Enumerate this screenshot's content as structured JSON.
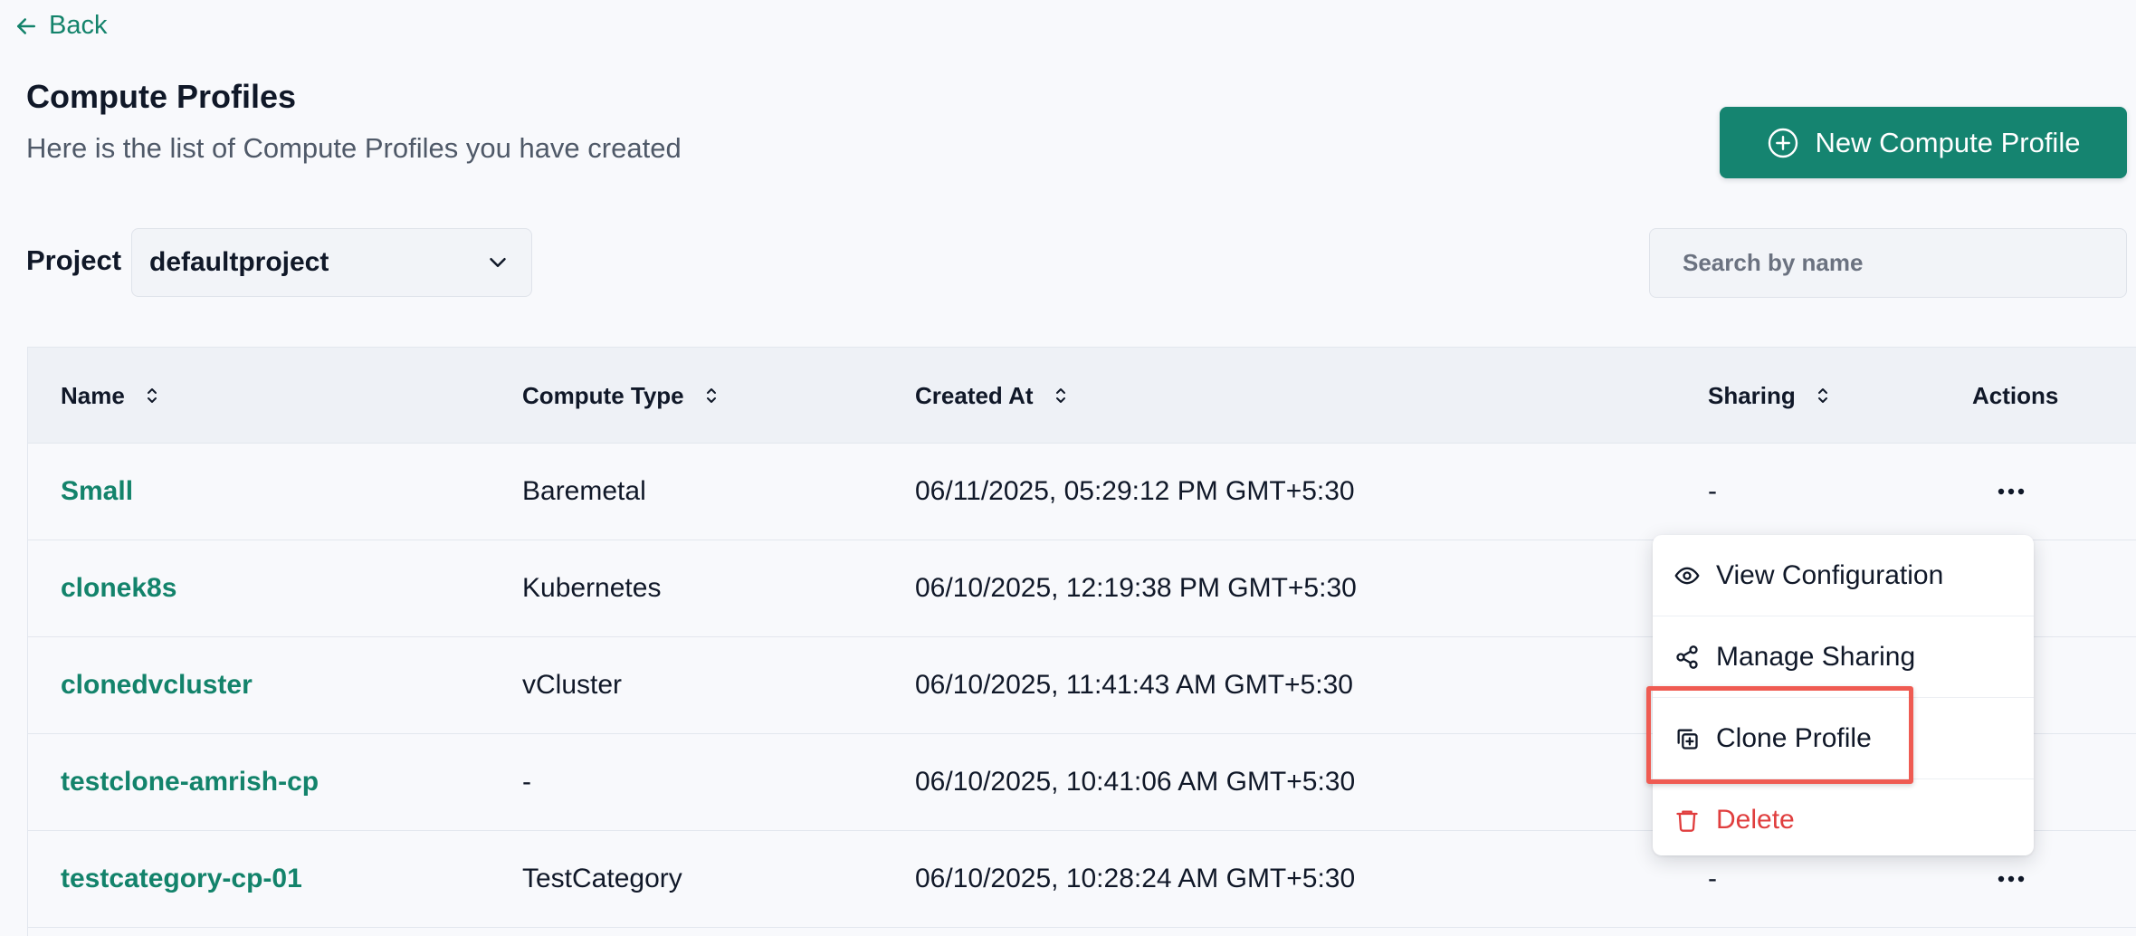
{
  "back": {
    "label": "Back"
  },
  "page": {
    "title": "Compute Profiles",
    "subtitle": "Here is the list of Compute Profiles you have created"
  },
  "new_button": {
    "label": "New Compute Profile"
  },
  "project": {
    "label": "Project",
    "selected": "defaultproject"
  },
  "search": {
    "placeholder": "Search by name",
    "value": ""
  },
  "table": {
    "columns": [
      "Name",
      "Compute Type",
      "Created At",
      "Sharing",
      "Actions"
    ],
    "rows": [
      {
        "name": "Small",
        "type": "Baremetal",
        "created": "06/11/2025, 05:29:12 PM GMT+5:30",
        "sharing": "-"
      },
      {
        "name": "clonek8s",
        "type": "Kubernetes",
        "created": "06/10/2025, 12:19:38 PM GMT+5:30",
        "sharing": ""
      },
      {
        "name": "clonedvcluster",
        "type": "vCluster",
        "created": "06/10/2025, 11:41:43 AM GMT+5:30",
        "sharing": ""
      },
      {
        "name": "testclone-amrish-cp",
        "type": "-",
        "created": "06/10/2025, 10:41:06 AM GMT+5:30",
        "sharing": ""
      },
      {
        "name": "testcategory-cp-01",
        "type": "TestCategory",
        "created": "06/10/2025, 10:28:24 AM GMT+5:30",
        "sharing": "-"
      }
    ]
  },
  "actions_menu": {
    "items": [
      {
        "label": "View Configuration",
        "icon": "eye-icon"
      },
      {
        "label": "Manage Sharing",
        "icon": "share-icon"
      },
      {
        "label": "Clone Profile",
        "icon": "clone-icon"
      },
      {
        "label": "Delete",
        "icon": "trash-icon"
      }
    ]
  },
  "colors": {
    "accent": "#158470",
    "link": "#13836b",
    "danger": "#e03e3e",
    "highlight": "#ef5b52"
  }
}
